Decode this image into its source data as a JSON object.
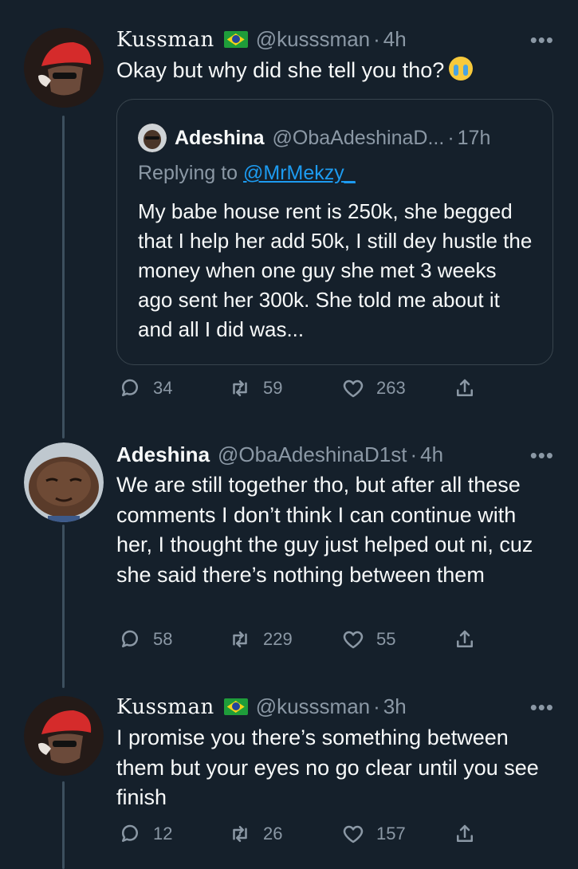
{
  "tweets": [
    {
      "name": "Kussman",
      "handle": "@kusssman",
      "time": "4h",
      "text": "Okay but why did she tell you tho?",
      "emoji": "loudly-crying-face",
      "quote": {
        "name": "Adeshina",
        "handle": "@ObaAdeshinaD...",
        "time": "17h",
        "replying_prefix": "Replying to ",
        "replying_to": "@MrMekzy_",
        "text": "My babe house rent is 250k, she begged that I help her add 50k, I still dey hustle the money when one guy she met 3 weeks ago sent her 300k. She told me about it and all I did was..."
      },
      "replies": "34",
      "retweets": "59",
      "likes": "263"
    },
    {
      "name": "Adeshina",
      "handle": "@ObaAdeshinaD1st",
      "time": "4h",
      "text": "We are still together tho, but after all these comments I don’t think I can continue with her, I thought the guy just helped out ni, cuz she said there’s nothing between them",
      "replies": "58",
      "retweets": "229",
      "likes": "55"
    },
    {
      "name": "Kussman",
      "handle": "@kusssman",
      "time": "3h",
      "text": "I promise you there’s something between them but your eyes no go clear until you see finish",
      "replies": "12",
      "retweets": "26",
      "likes": "157"
    }
  ],
  "ui": {
    "separator": "·",
    "more": "•••"
  },
  "colors": {
    "background": "#15202b",
    "text": "#f7f9f9",
    "muted": "#8b98a5",
    "link": "#1d9bf0",
    "border": "#38444d"
  },
  "icons": [
    "reply-icon",
    "retweet-icon",
    "like-icon",
    "share-icon",
    "more-icon",
    "brazil-flag-icon",
    "loudly-crying-face-emoji"
  ]
}
